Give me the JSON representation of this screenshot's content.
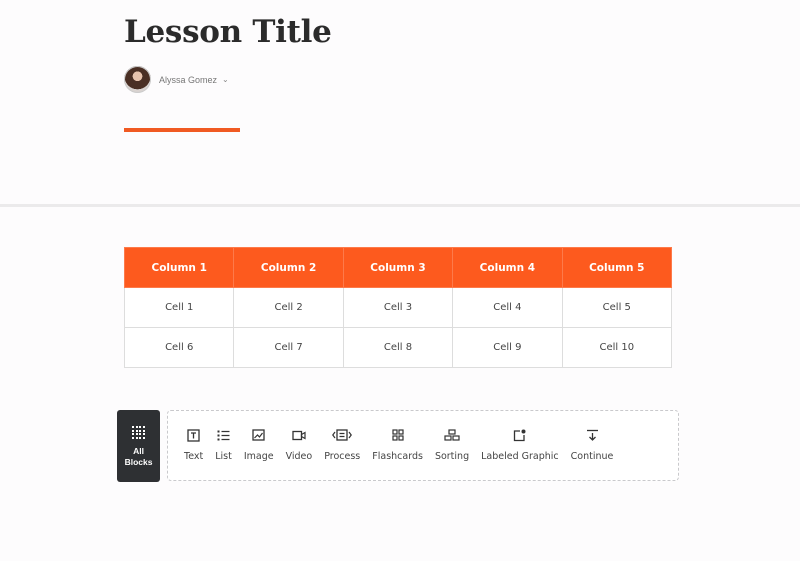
{
  "lesson": {
    "title": "Lesson Title",
    "author": "Alyssa Gomez",
    "accent_color": "#f05a22"
  },
  "table": {
    "header_color": "#fd5a1e",
    "columns": [
      "Column 1",
      "Column 2",
      "Column 3",
      "Column 4",
      "Column 5"
    ],
    "rows": [
      [
        "Cell 1",
        "Cell 2",
        "Cell 3",
        "Cell 4",
        "Cell 5"
      ],
      [
        "Cell 6",
        "Cell 7",
        "Cell 8",
        "Cell 9",
        "Cell 10"
      ]
    ]
  },
  "block_toolbar": {
    "all_blocks_line1": "All",
    "all_blocks_line2": "Blocks",
    "items": [
      {
        "label": "Text",
        "icon": "text-icon"
      },
      {
        "label": "List",
        "icon": "list-icon"
      },
      {
        "label": "Image",
        "icon": "image-icon"
      },
      {
        "label": "Video",
        "icon": "video-icon"
      },
      {
        "label": "Process",
        "icon": "process-icon"
      },
      {
        "label": "Flashcards",
        "icon": "flashcards-icon"
      },
      {
        "label": "Sorting",
        "icon": "sorting-icon"
      },
      {
        "label": "Labeled Graphic",
        "icon": "labeled-graphic-icon"
      },
      {
        "label": "Continue",
        "icon": "continue-icon"
      }
    ]
  }
}
